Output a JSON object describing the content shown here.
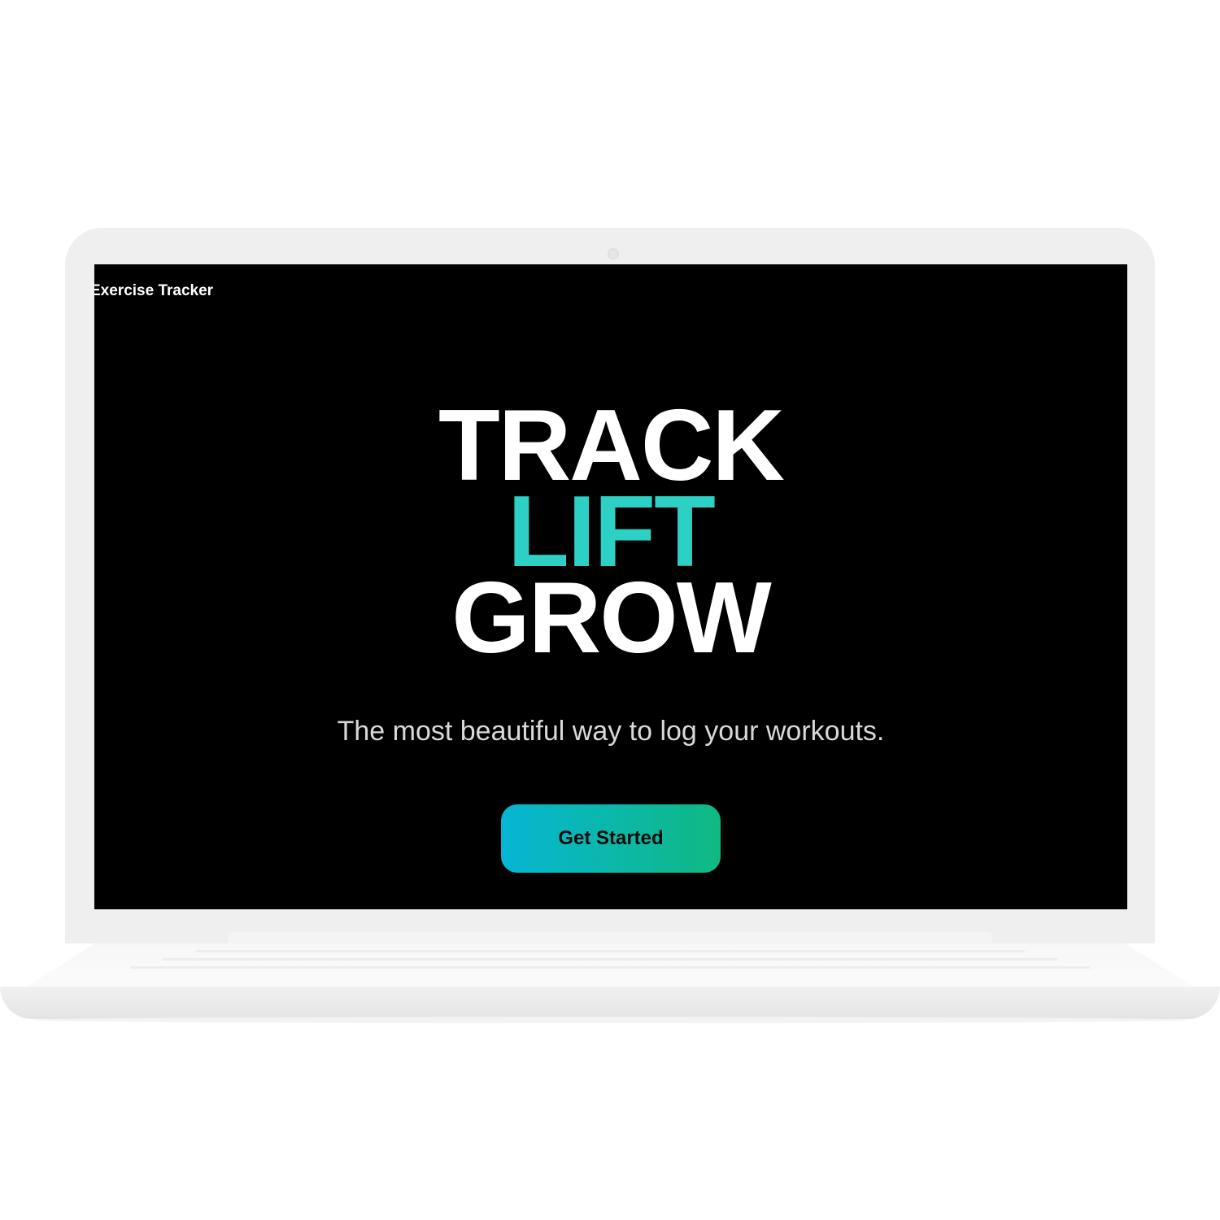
{
  "app": {
    "title": "Exercise Tracker"
  },
  "hero": {
    "line1": "TRACK",
    "line2": "LIFT",
    "line3": "GROW"
  },
  "subtitle": "The most beautiful way to log your workouts.",
  "cta": {
    "label": "Get Started"
  },
  "colors": {
    "screen_background": "#000000",
    "accent": "#2cd0c4",
    "button_gradient_start": "#06b6d4",
    "button_gradient_end": "#10b981",
    "device_frame": "#efefef"
  }
}
